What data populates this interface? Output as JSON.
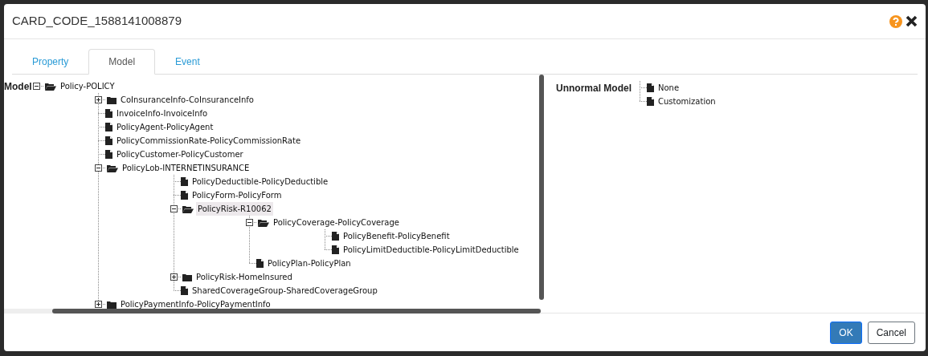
{
  "window": {
    "title": "CARD_CODE_1588141008879"
  },
  "tabs": [
    {
      "label": "Property",
      "selected": false
    },
    {
      "label": "Model",
      "selected": true
    },
    {
      "label": "Event",
      "selected": false
    }
  ],
  "model_tree": {
    "label": "Model",
    "nodes": [
      {
        "label": "Policy-POLICY",
        "kind": "folder",
        "expanded": true,
        "selected": false,
        "children": [
          {
            "label": "CoInsuranceInfo-CoInsuranceInfo",
            "kind": "folder",
            "expanded": false,
            "selected": false
          },
          {
            "label": "InvoiceInfo-InvoiceInfo",
            "kind": "leaf",
            "selected": false
          },
          {
            "label": "PolicyAgent-PolicyAgent",
            "kind": "leaf",
            "selected": false
          },
          {
            "label": "PolicyCommissionRate-PolicyCommissionRate",
            "kind": "leaf",
            "selected": false
          },
          {
            "label": "PolicyCustomer-PolicyCustomer",
            "kind": "leaf",
            "selected": false
          },
          {
            "label": "PolicyLob-INTERNETINSURANCE",
            "kind": "folder",
            "expanded": true,
            "selected": false,
            "children": [
              {
                "label": "PolicyDeductible-PolicyDeductible",
                "kind": "leaf",
                "selected": false
              },
              {
                "label": "PolicyForm-PolicyForm",
                "kind": "leaf",
                "selected": false
              },
              {
                "label": "PolicyRisk-R10062",
                "kind": "folder",
                "expanded": true,
                "selected": true,
                "children": [
                  {
                    "label": "PolicyCoverage-PolicyCoverage",
                    "kind": "folder",
                    "expanded": true,
                    "selected": false,
                    "children": [
                      {
                        "label": "PolicyBenefit-PolicyBenefit",
                        "kind": "leaf",
                        "selected": false
                      },
                      {
                        "label": "PolicyLimitDeductible-PolicyLimitDeductible",
                        "kind": "leaf",
                        "selected": false
                      }
                    ]
                  },
                  {
                    "label": "PolicyPlan-PolicyPlan",
                    "kind": "leaf",
                    "selected": false
                  }
                ]
              },
              {
                "label": "PolicyRisk-HomeInsured",
                "kind": "folder",
                "expanded": false,
                "selected": false
              },
              {
                "label": "SharedCoverageGroup-SharedCoverageGroup",
                "kind": "leaf",
                "selected": false
              }
            ]
          },
          {
            "label": "PolicyPaymentInfo-PolicyPaymentInfo",
            "kind": "folder",
            "expanded": false,
            "selected": false
          }
        ]
      }
    ]
  },
  "unnormal_model": {
    "label": "Unnormal Model",
    "nodes": [
      {
        "label": "None",
        "kind": "leaf",
        "selected": false
      },
      {
        "label": "Customization",
        "kind": "leaf",
        "selected": false
      }
    ]
  },
  "buttons": [
    {
      "label": "OK",
      "kind": "primary"
    },
    {
      "label": "Cancel",
      "kind": "secondary"
    }
  ]
}
